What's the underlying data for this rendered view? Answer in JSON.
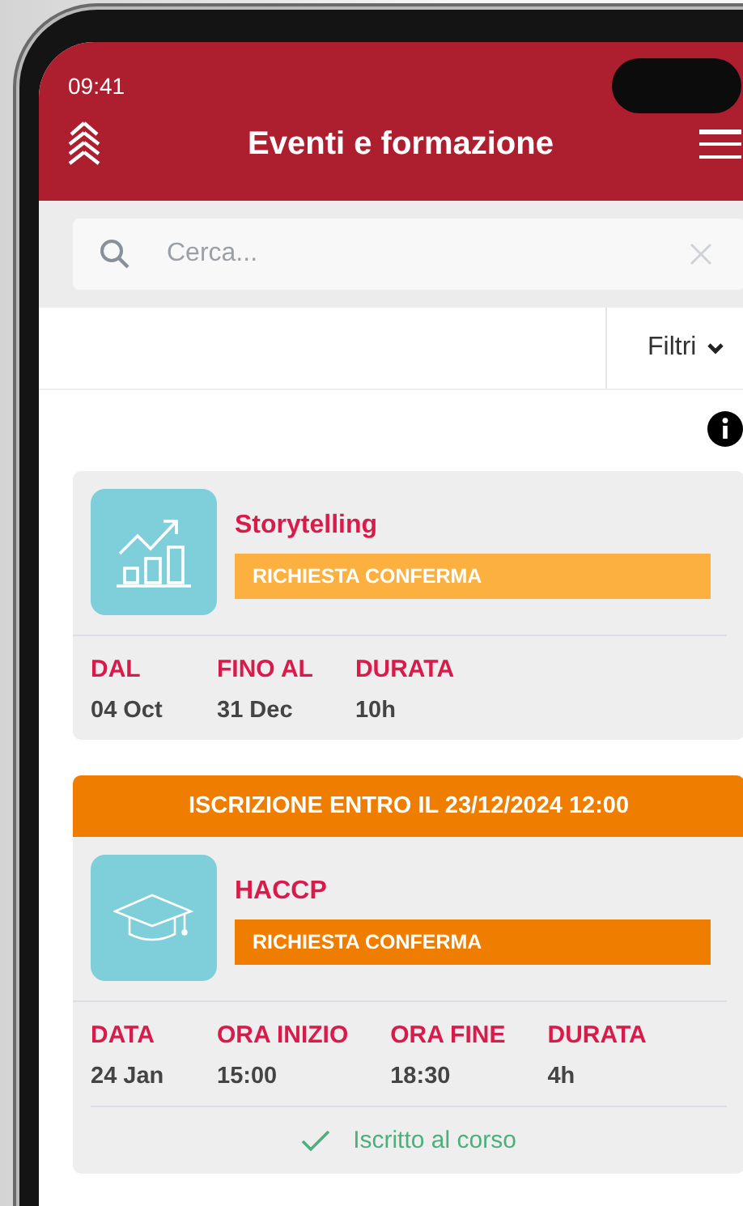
{
  "status_bar": {
    "time": "09:41"
  },
  "header": {
    "title": "Eventi e formazione"
  },
  "search": {
    "placeholder": "Cerca..."
  },
  "filter": {
    "label": "Filtri"
  },
  "events": [
    {
      "kind": "chart",
      "title": "Storytelling",
      "badge": {
        "label": "RICHIESTA CONFERMA",
        "color": "#fbb040"
      },
      "fields": [
        {
          "label": "DAL",
          "value": "04 Oct"
        },
        {
          "label": "FINO AL",
          "value": "31 Dec"
        },
        {
          "label": "DURATA",
          "value": "10h"
        }
      ]
    },
    {
      "deadline": "ISCRIZIONE ENTRO IL 23/12/2024 12:00",
      "kind": "course",
      "title": "HACCP",
      "badge": {
        "label": "RICHIESTA CONFERMA",
        "color": "#ef7d00"
      },
      "fields": [
        {
          "label": "DATA",
          "value": "24 Jan"
        },
        {
          "label": "ORA INIZIO",
          "value": "15:00"
        },
        {
          "label": "ORA FINE",
          "value": "18:30"
        },
        {
          "label": "DURATA",
          "value": "4h"
        }
      ],
      "status": "Iscritto al corso"
    }
  ]
}
